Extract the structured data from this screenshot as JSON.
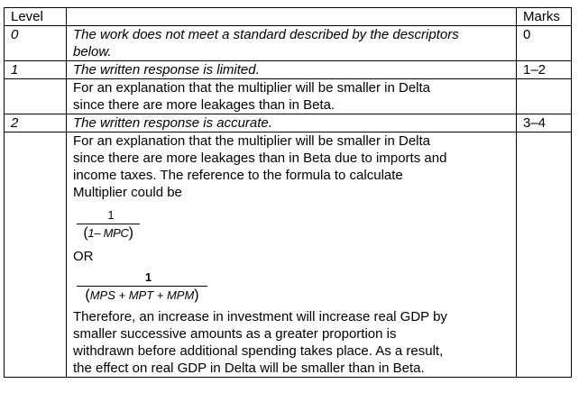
{
  "header": {
    "level": "Level",
    "description": "",
    "marks": "Marks"
  },
  "rows": [
    {
      "level": "0",
      "descriptor_lines": [
        "The work does not meet a standard described by the descriptors",
        "below."
      ],
      "marks": "0"
    },
    {
      "level": "1",
      "descriptor": "The written response is limited.",
      "marks": "1–2",
      "explanation_lines": [
        "For an explanation that the multiplier will be smaller in Delta",
        "since there are more leakages than in Beta."
      ]
    },
    {
      "level": "2",
      "descriptor": "The written response is accurate.",
      "marks": "3–4",
      "explanation_lines": [
        "For an explanation that the multiplier will be smaller in Delta",
        "since there are more leakages than in Beta due to imports and",
        "income taxes. The reference to the formula to calculate",
        "Multiplier could be"
      ],
      "formula_1": {
        "numerator": "1",
        "denominator_left": "(",
        "denominator_text": "1– MPC",
        "denominator_right": ")"
      },
      "or_text": "OR",
      "formula_2": {
        "numerator": "1",
        "denominator_left": "(",
        "denominator_text": "MPS + MPT + MPM",
        "denominator_right": ")"
      },
      "conclusion_lines": [
        "Therefore, an increase in investment will increase real GDP by",
        "smaller successive amounts as a greater proportion is",
        "withdrawn before additional spending takes place.  As a result,",
        "the effect on real GDP in Delta will be smaller than in Beta."
      ]
    }
  ]
}
